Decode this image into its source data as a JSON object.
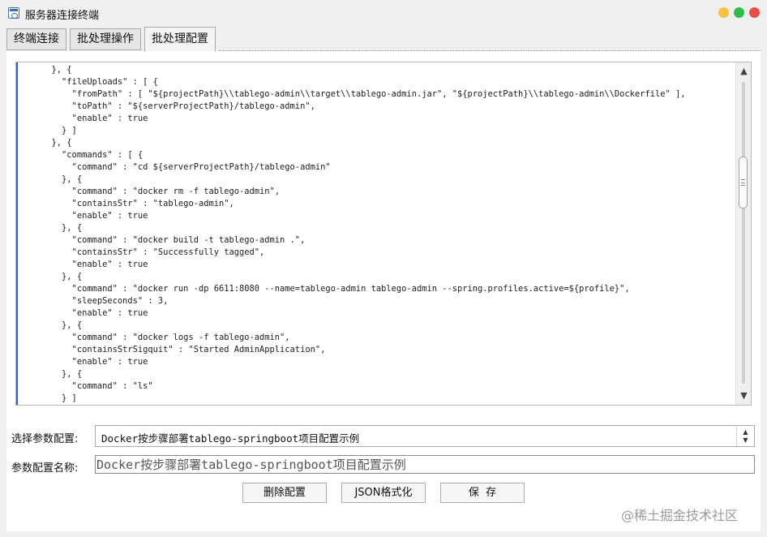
{
  "window": {
    "title": "服务器连接终端"
  },
  "tabs": [
    {
      "label": "终端连接",
      "active": false
    },
    {
      "label": "批处理操作",
      "active": false
    },
    {
      "label": "批处理配置",
      "active": true
    }
  ],
  "editor": {
    "lines": [
      "      }, {",
      "        \"fileUploads\" : [ {",
      "          \"fromPath\" : [ \"${projectPath}\\\\tablego-admin\\\\target\\\\tablego-admin.jar\", \"${projectPath}\\\\tablego-admin\\\\Dockerfile\" ],",
      "          \"toPath\" : \"${serverProjectPath}/tablego-admin\",",
      "          \"enable\" : true",
      "        } ]",
      "      }, {",
      "        \"commands\" : [ {",
      "          \"command\" : \"cd ${serverProjectPath}/tablego-admin\"",
      "        }, {",
      "          \"command\" : \"docker rm -f tablego-admin\",",
      "          \"containsStr\" : \"tablego-admin\",",
      "          \"enable\" : true",
      "        }, {",
      "          \"command\" : \"docker build -t tablego-admin .\",",
      "          \"containsStr\" : \"Successfully tagged\",",
      "          \"enable\" : true",
      "        }, {",
      "          \"command\" : \"docker run -dp 6611:8080 --name=tablego-admin tablego-admin --spring.profiles.active=${profile}\",",
      "          \"sleepSeconds\" : 3,",
      "          \"enable\" : true",
      "        }, {",
      "          \"command\" : \"docker logs -f tablego-admin\",",
      "          \"containsStrSigquit\" : \"Started AdminApplication\",",
      "          \"enable\" : true",
      "        }, {",
      "          \"command\" : \"ls\"",
      "        } ]"
    ]
  },
  "form": {
    "config_select_label": "选择参数配置:",
    "config_select_value": "Docker按步骤部署tablego-springboot项目配置示例",
    "config_name_label": "参数配置名称:",
    "config_name_value": "Docker按步骤部署tablego-springboot项目配置示例"
  },
  "buttons": {
    "delete_label": "删除配置",
    "json_format_label": "JSON格式化",
    "save_label": "保  存"
  },
  "scrollbar": {
    "up_icon": "▲",
    "down_icon": "▼"
  },
  "select_arrow": {
    "up": "▲",
    "down": "▼"
  },
  "watermark": "@稀土掘金技术社区",
  "colors": {
    "accent": "#2a64c5",
    "win_min": "#f5c242",
    "win_max": "#2bbf4a",
    "win_close": "#ee4b4b"
  }
}
